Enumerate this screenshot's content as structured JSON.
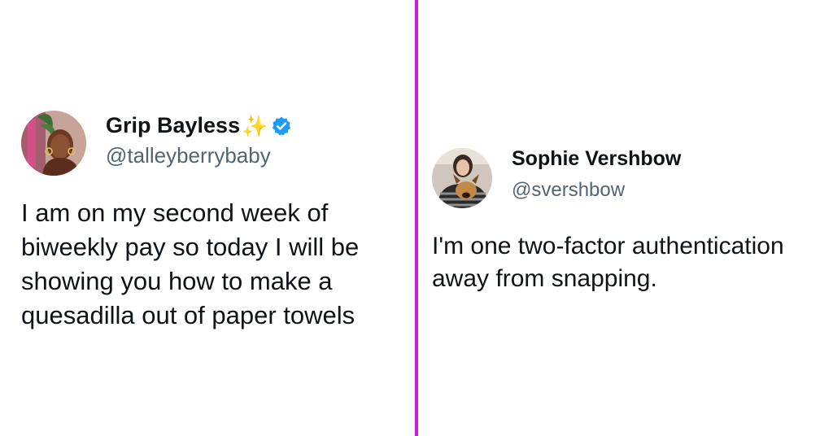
{
  "tweets": [
    {
      "display_name": "Grip Bayless",
      "name_emoji": "✨",
      "verified": true,
      "handle": "@talleyberrybaby",
      "text": "I am on my second week of biweekly pay so today I will be showing you how to make a quesadilla out of paper towels"
    },
    {
      "display_name": "Sophie Vershbow",
      "handle": "@svershbow",
      "text": "I'm one two-factor authentication away from snapping."
    }
  ],
  "colors": {
    "divider": "#c81fd6",
    "verified_badge": "#1d9bf0",
    "handle": "#536471",
    "text": "#0f1419"
  },
  "icons": {
    "verified": "verified-badge-icon",
    "sparkle": "sparkles-icon"
  }
}
